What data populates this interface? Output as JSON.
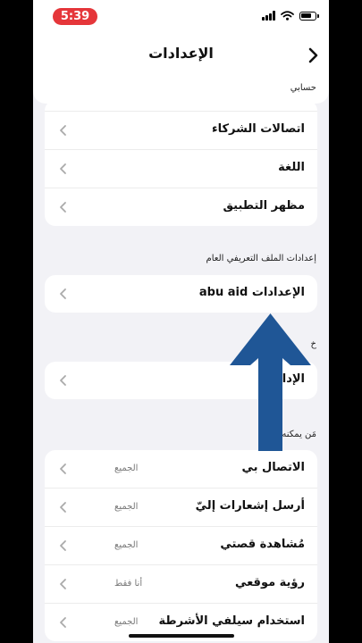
{
  "status_bar": {
    "time": "5:39"
  },
  "header": {
    "title": "الإعدادات"
  },
  "account_section": {
    "label": "حسابي"
  },
  "account_rows": [
    {
      "label": "اتصالات الشركاء"
    },
    {
      "label": "اللغة"
    },
    {
      "label": "مظهر التطبيق"
    }
  ],
  "public_profile": {
    "title": "إعدادات الملف التعريفي العام",
    "row_label": "الإعدادات abu aid"
  },
  "partial_section": {
    "title": "خ",
    "row_label": "الإدار"
  },
  "privacy": {
    "title": "مَن يمكنه...",
    "rows": [
      {
        "label": "الاتصال بي",
        "value": "الجميع"
      },
      {
        "label": "أرسل إشعارات إليّ",
        "value": "الجميع"
      },
      {
        "label": "مُشاهدة قصتي",
        "value": "الجميع"
      },
      {
        "label": "رؤية موقعي",
        "value": "أنا فقط"
      },
      {
        "label": "استخدام سيلفي الأشرطة",
        "value": "الجميع"
      }
    ]
  },
  "colors": {
    "background": "#f2f2f6",
    "time_pill": "#e5363a",
    "arrow": "#1f5696"
  },
  "icons": [
    "back-chevron-icon",
    "chevron-left-icon",
    "signal-icon",
    "wifi-icon",
    "battery-icon",
    "up-arrow-annotation"
  ]
}
